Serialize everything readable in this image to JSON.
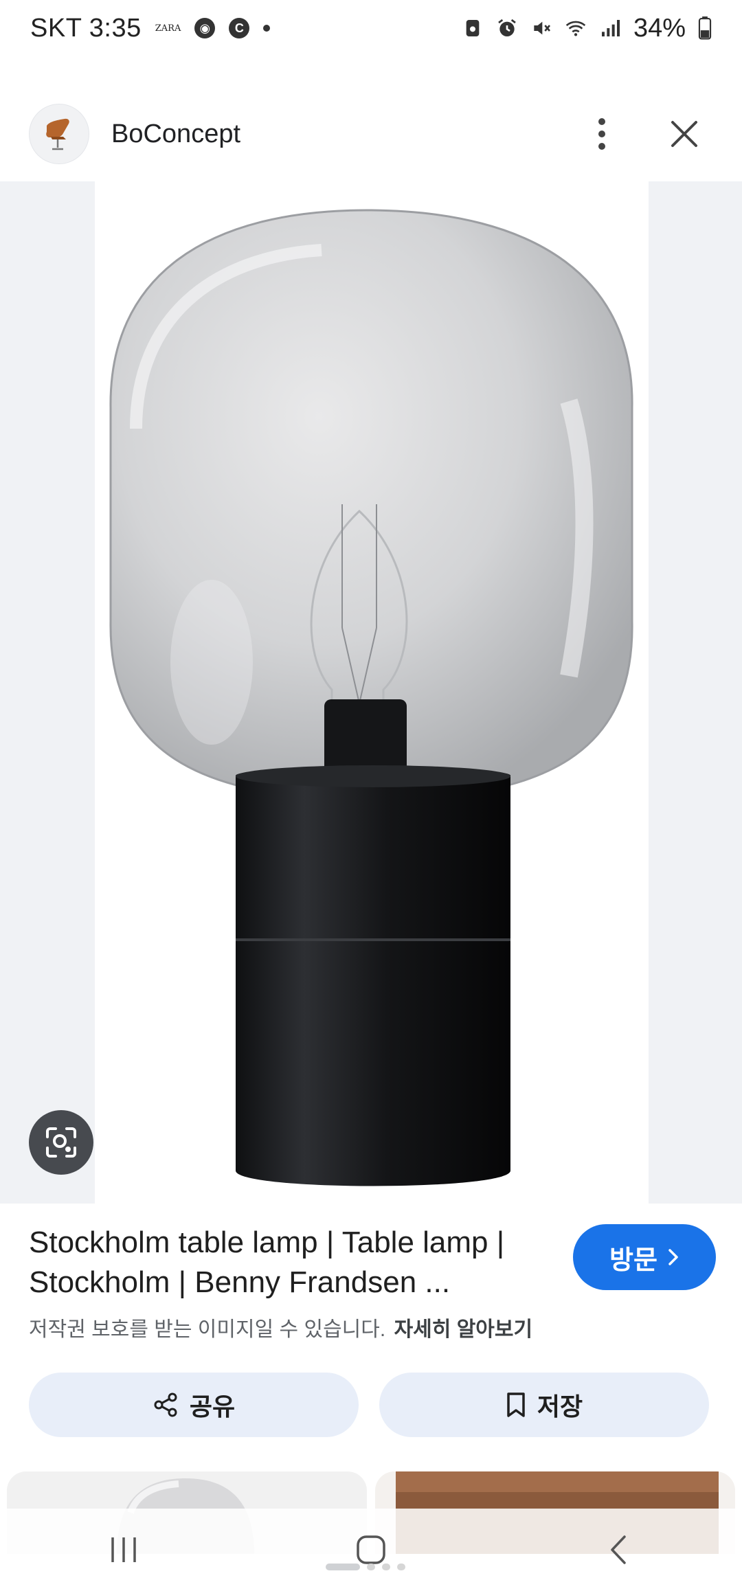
{
  "status_bar": {
    "carrier_time": "SKT 3:35",
    "mini_label": "ZARA",
    "badge_letter": "C",
    "battery": "34%"
  },
  "top_bar": {
    "site_name": "BoConcept",
    "icons": {
      "avatar": "chair-logo-icon",
      "menu": "more-vertical-icon",
      "close": "close-icon"
    }
  },
  "image": {
    "subject": "lamp-image",
    "lens_icon": "lens-search-icon"
  },
  "result": {
    "title": "Stockholm table lamp | Table lamp | Stockholm | Benny Frandsen ...",
    "visit_label": "방문",
    "copyright_text": "저작권 보호를 받는 이미지일 수 있습니다.",
    "learn_more": "자세히 알아보기"
  },
  "actions": {
    "share_label": "공유",
    "save_label": "저장"
  },
  "colors": {
    "accent": "#1a73e8",
    "pill_bg": "#e8eef9",
    "image_bg": "#f0f2f5"
  }
}
